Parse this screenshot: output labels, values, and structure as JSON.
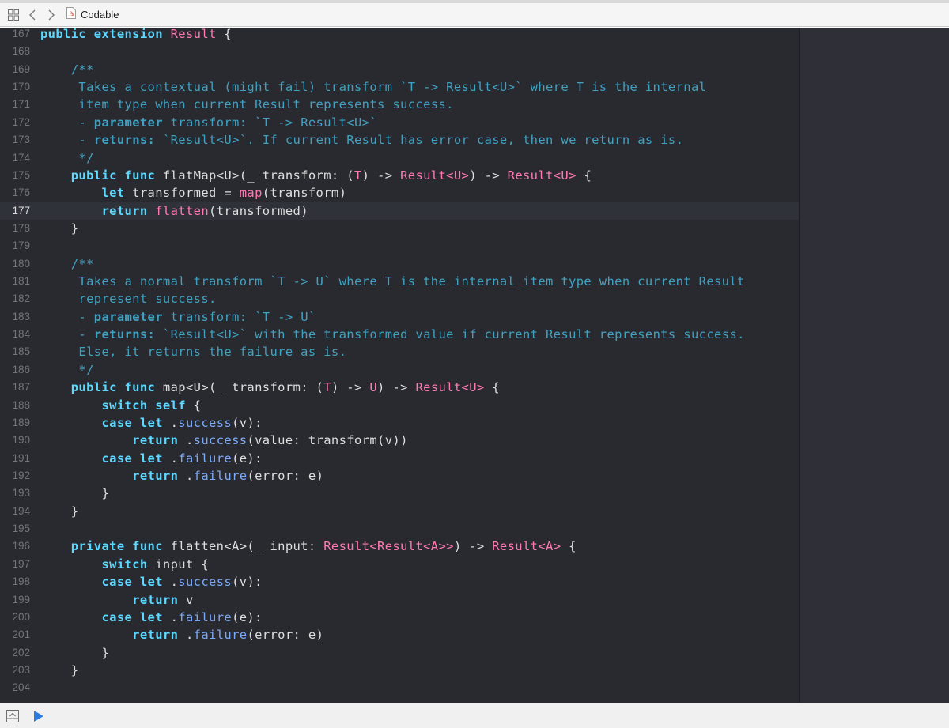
{
  "window": {
    "file_name": "Codable"
  },
  "jumpbar": {
    "icons": [
      "related-items-icon",
      "back-icon",
      "forward-icon",
      "swift-file-icon"
    ]
  },
  "bottom_bar": {
    "icons": [
      "hide-debug-area-icon",
      "run-icon"
    ]
  },
  "colors": {
    "editor_background": "#292a30",
    "keyword": "#5dd8ff",
    "type": "#ff7ab2",
    "doc_comment": "#41a1c0",
    "plain": "#dfdfe0",
    "line_number": "#747478",
    "run_button": "#2c7be5"
  },
  "editor": {
    "current_line": "177",
    "lines": [
      {
        "n": "167",
        "segs": [
          [
            "kwb",
            "public extension "
          ],
          [
            "typ",
            "Result"
          ],
          [
            "plain",
            " {"
          ]
        ]
      },
      {
        "n": "168",
        "segs": [
          [
            "plain",
            ""
          ]
        ]
      },
      {
        "n": "169",
        "segs": [
          [
            "docs",
            "    /**"
          ]
        ]
      },
      {
        "n": "170",
        "segs": [
          [
            "docs",
            "     Takes a contextual (might fail) transform `T -> Result<U>` where T is the internal"
          ]
        ]
      },
      {
        "n": "171",
        "segs": [
          [
            "docs",
            "     item type when current Result represents success."
          ]
        ]
      },
      {
        "n": "172",
        "segs": [
          [
            "docs",
            "     - "
          ],
          [
            "docb",
            "parameter"
          ],
          [
            "docs",
            " transform: `T -> Result<U>`"
          ]
        ]
      },
      {
        "n": "173",
        "segs": [
          [
            "docs",
            "     - "
          ],
          [
            "docb",
            "returns:"
          ],
          [
            "docs",
            " `Result<U>`. If current Result has error case, then we return as is."
          ]
        ]
      },
      {
        "n": "174",
        "segs": [
          [
            "docs",
            "     */"
          ]
        ]
      },
      {
        "n": "175",
        "segs": [
          [
            "kwb",
            "    public func "
          ],
          [
            "plain",
            "flatMap<U>(_ transform: ("
          ],
          [
            "typ",
            "T"
          ],
          [
            "plain",
            ") -> "
          ],
          [
            "typ",
            "Result<U>"
          ],
          [
            "plain",
            ") -> "
          ],
          [
            "typ",
            "Result<U>"
          ],
          [
            "plain",
            " {"
          ]
        ]
      },
      {
        "n": "176",
        "segs": [
          [
            "kwb",
            "        let "
          ],
          [
            "plain",
            "transformed = "
          ],
          [
            "typ",
            "map"
          ],
          [
            "plain",
            "(transform)"
          ]
        ]
      },
      {
        "n": "177",
        "segs": [
          [
            "kwb",
            "        return "
          ],
          [
            "typ",
            "flatten"
          ],
          [
            "plain",
            "(transformed)"
          ]
        ]
      },
      {
        "n": "178",
        "segs": [
          [
            "plain",
            "    }"
          ]
        ]
      },
      {
        "n": "179",
        "segs": [
          [
            "plain",
            ""
          ]
        ]
      },
      {
        "n": "180",
        "segs": [
          [
            "docs",
            "    /**"
          ]
        ]
      },
      {
        "n": "181",
        "segs": [
          [
            "docs",
            "     Takes a normal transform `T -> U` where T is the internal item type when current Result"
          ]
        ]
      },
      {
        "n": "182",
        "segs": [
          [
            "docs",
            "     represent success."
          ]
        ]
      },
      {
        "n": "183",
        "segs": [
          [
            "docs",
            "     - "
          ],
          [
            "docb",
            "parameter"
          ],
          [
            "docs",
            " transform: `T -> U`"
          ]
        ]
      },
      {
        "n": "184",
        "segs": [
          [
            "docs",
            "     - "
          ],
          [
            "docb",
            "returns:"
          ],
          [
            "docs",
            " `Result<U>` with the transformed value if current Result represents success."
          ]
        ]
      },
      {
        "n": "185",
        "segs": [
          [
            "docs",
            "     Else, it returns the failure as is."
          ]
        ]
      },
      {
        "n": "186",
        "segs": [
          [
            "docs",
            "     */"
          ]
        ]
      },
      {
        "n": "187",
        "segs": [
          [
            "kwb",
            "    public func "
          ],
          [
            "plain",
            "map<U>(_ transform: ("
          ],
          [
            "typ",
            "T"
          ],
          [
            "plain",
            ") -> "
          ],
          [
            "typ",
            "U"
          ],
          [
            "plain",
            ") -> "
          ],
          [
            "typ",
            "Result<U>"
          ],
          [
            "plain",
            " {"
          ]
        ]
      },
      {
        "n": "188",
        "segs": [
          [
            "kwb",
            "        switch self "
          ],
          [
            "plain",
            "{"
          ]
        ]
      },
      {
        "n": "189",
        "segs": [
          [
            "kwb",
            "        case let "
          ],
          [
            "plain",
            "."
          ],
          [
            "mem",
            "success"
          ],
          [
            "plain",
            "(v):"
          ]
        ]
      },
      {
        "n": "190",
        "segs": [
          [
            "kwb",
            "            return "
          ],
          [
            "plain",
            "."
          ],
          [
            "mem",
            "success"
          ],
          [
            "plain",
            "(value: transform(v))"
          ]
        ]
      },
      {
        "n": "191",
        "segs": [
          [
            "kwb",
            "        case let "
          ],
          [
            "plain",
            "."
          ],
          [
            "mem",
            "failure"
          ],
          [
            "plain",
            "(e):"
          ]
        ]
      },
      {
        "n": "192",
        "segs": [
          [
            "kwb",
            "            return "
          ],
          [
            "plain",
            "."
          ],
          [
            "mem",
            "failure"
          ],
          [
            "plain",
            "(error: e)"
          ]
        ]
      },
      {
        "n": "193",
        "segs": [
          [
            "plain",
            "        }"
          ]
        ]
      },
      {
        "n": "194",
        "segs": [
          [
            "plain",
            "    }"
          ]
        ]
      },
      {
        "n": "195",
        "segs": [
          [
            "plain",
            ""
          ]
        ]
      },
      {
        "n": "196",
        "segs": [
          [
            "kwb",
            "    private func "
          ],
          [
            "plain",
            "flatten<A>(_ input: "
          ],
          [
            "typ",
            "Result<Result<A>>"
          ],
          [
            "plain",
            ") -> "
          ],
          [
            "typ",
            "Result<A>"
          ],
          [
            "plain",
            " {"
          ]
        ]
      },
      {
        "n": "197",
        "segs": [
          [
            "kwb",
            "        switch "
          ],
          [
            "plain",
            "input {"
          ]
        ]
      },
      {
        "n": "198",
        "segs": [
          [
            "kwb",
            "        case let "
          ],
          [
            "plain",
            "."
          ],
          [
            "mem",
            "success"
          ],
          [
            "plain",
            "(v):"
          ]
        ]
      },
      {
        "n": "199",
        "segs": [
          [
            "kwb",
            "            return "
          ],
          [
            "plain",
            "v"
          ]
        ]
      },
      {
        "n": "200",
        "segs": [
          [
            "kwb",
            "        case let "
          ],
          [
            "plain",
            "."
          ],
          [
            "mem",
            "failure"
          ],
          [
            "plain",
            "(e):"
          ]
        ]
      },
      {
        "n": "201",
        "segs": [
          [
            "kwb",
            "            return "
          ],
          [
            "plain",
            "."
          ],
          [
            "mem",
            "failure"
          ],
          [
            "plain",
            "(error: e)"
          ]
        ]
      },
      {
        "n": "202",
        "segs": [
          [
            "plain",
            "        }"
          ]
        ]
      },
      {
        "n": "203",
        "segs": [
          [
            "plain",
            "    }"
          ]
        ]
      },
      {
        "n": "204",
        "segs": [
          [
            "plain",
            ""
          ]
        ]
      }
    ]
  }
}
